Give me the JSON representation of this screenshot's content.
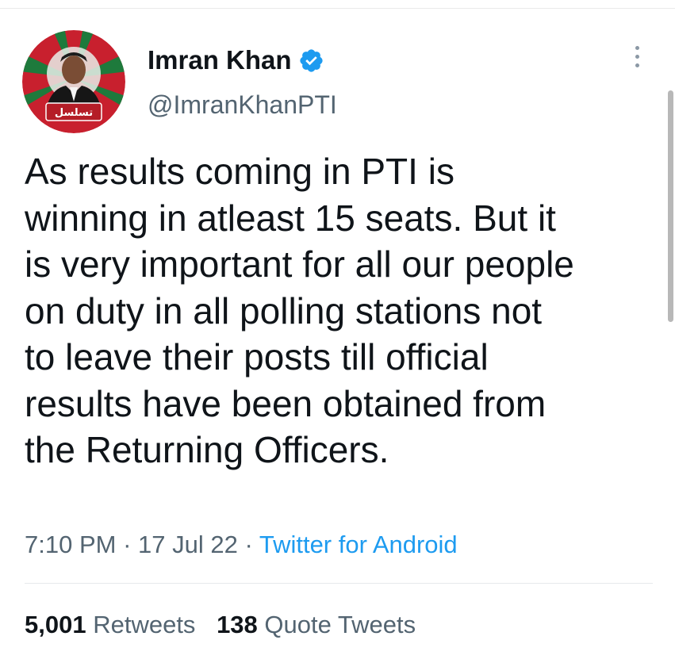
{
  "author": {
    "display_name": "Imran Khan",
    "handle": "@ImranKhanPTI",
    "verified_icon": "verified-badge-icon",
    "avatar_badge_text": "تسلسل",
    "colors": {
      "verified": "#1d9bf0",
      "avatar_red": "#c8202e",
      "avatar_green": "#1e7a3c"
    }
  },
  "tweet": {
    "text": "As results coming in PTI is\nwinning in atleast 15 seats. But it\nis very important for all our people\non duty in all polling stations not\nto leave their posts till official\nresults have been obtained from\nthe Returning Officers."
  },
  "meta": {
    "time": "7:10 PM",
    "separator": " · ",
    "date": "17 Jul 22",
    "source": "Twitter for Android"
  },
  "stats": {
    "retweets_count": "5,001",
    "retweets_label": "Retweets",
    "quotes_count": "138",
    "quotes_label": "Quote Tweets"
  },
  "icons": {
    "more": "more-options-icon"
  }
}
